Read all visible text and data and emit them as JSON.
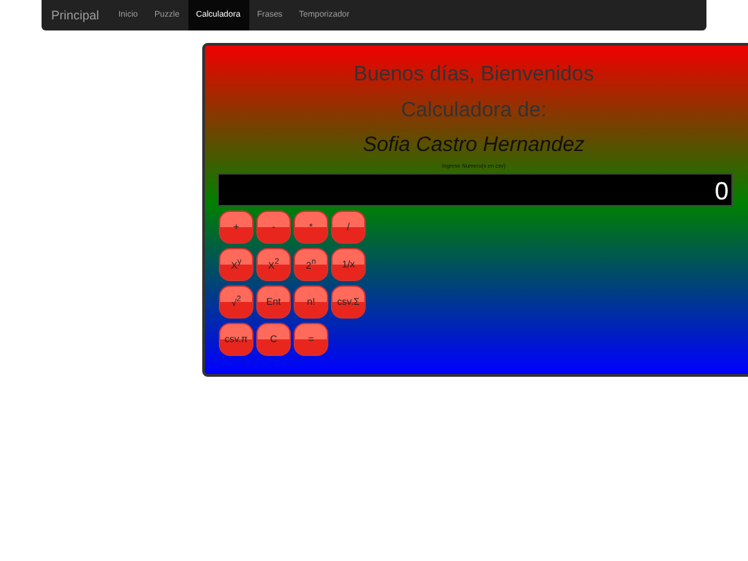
{
  "navbar": {
    "brand": "Principal",
    "items": [
      {
        "label": "Inicio",
        "selected": false
      },
      {
        "label": "Puzzle",
        "selected": false
      },
      {
        "label": "Calculadora",
        "selected": true
      },
      {
        "label": "Frases",
        "selected": false
      },
      {
        "label": "Temporizador",
        "selected": false
      }
    ]
  },
  "calculator": {
    "greeting": "Buenos días, Bienvenidos",
    "subtitle": "Calculadora de:",
    "owner": "Sofia Castro Hernandez",
    "hint": "Ingrese Numero(s en csv)",
    "display": "0",
    "keys": [
      [
        "+",
        "-",
        "*",
        "/"
      ],
      [
        "X$^{y}$",
        "X$^{2}$",
        "2$^{n}$",
        "1/x"
      ],
      [
        "√$^{2}$",
        "Ent",
        "n!",
        "csv.Σ"
      ],
      [
        "csv.π",
        "C",
        "="
      ]
    ]
  }
}
